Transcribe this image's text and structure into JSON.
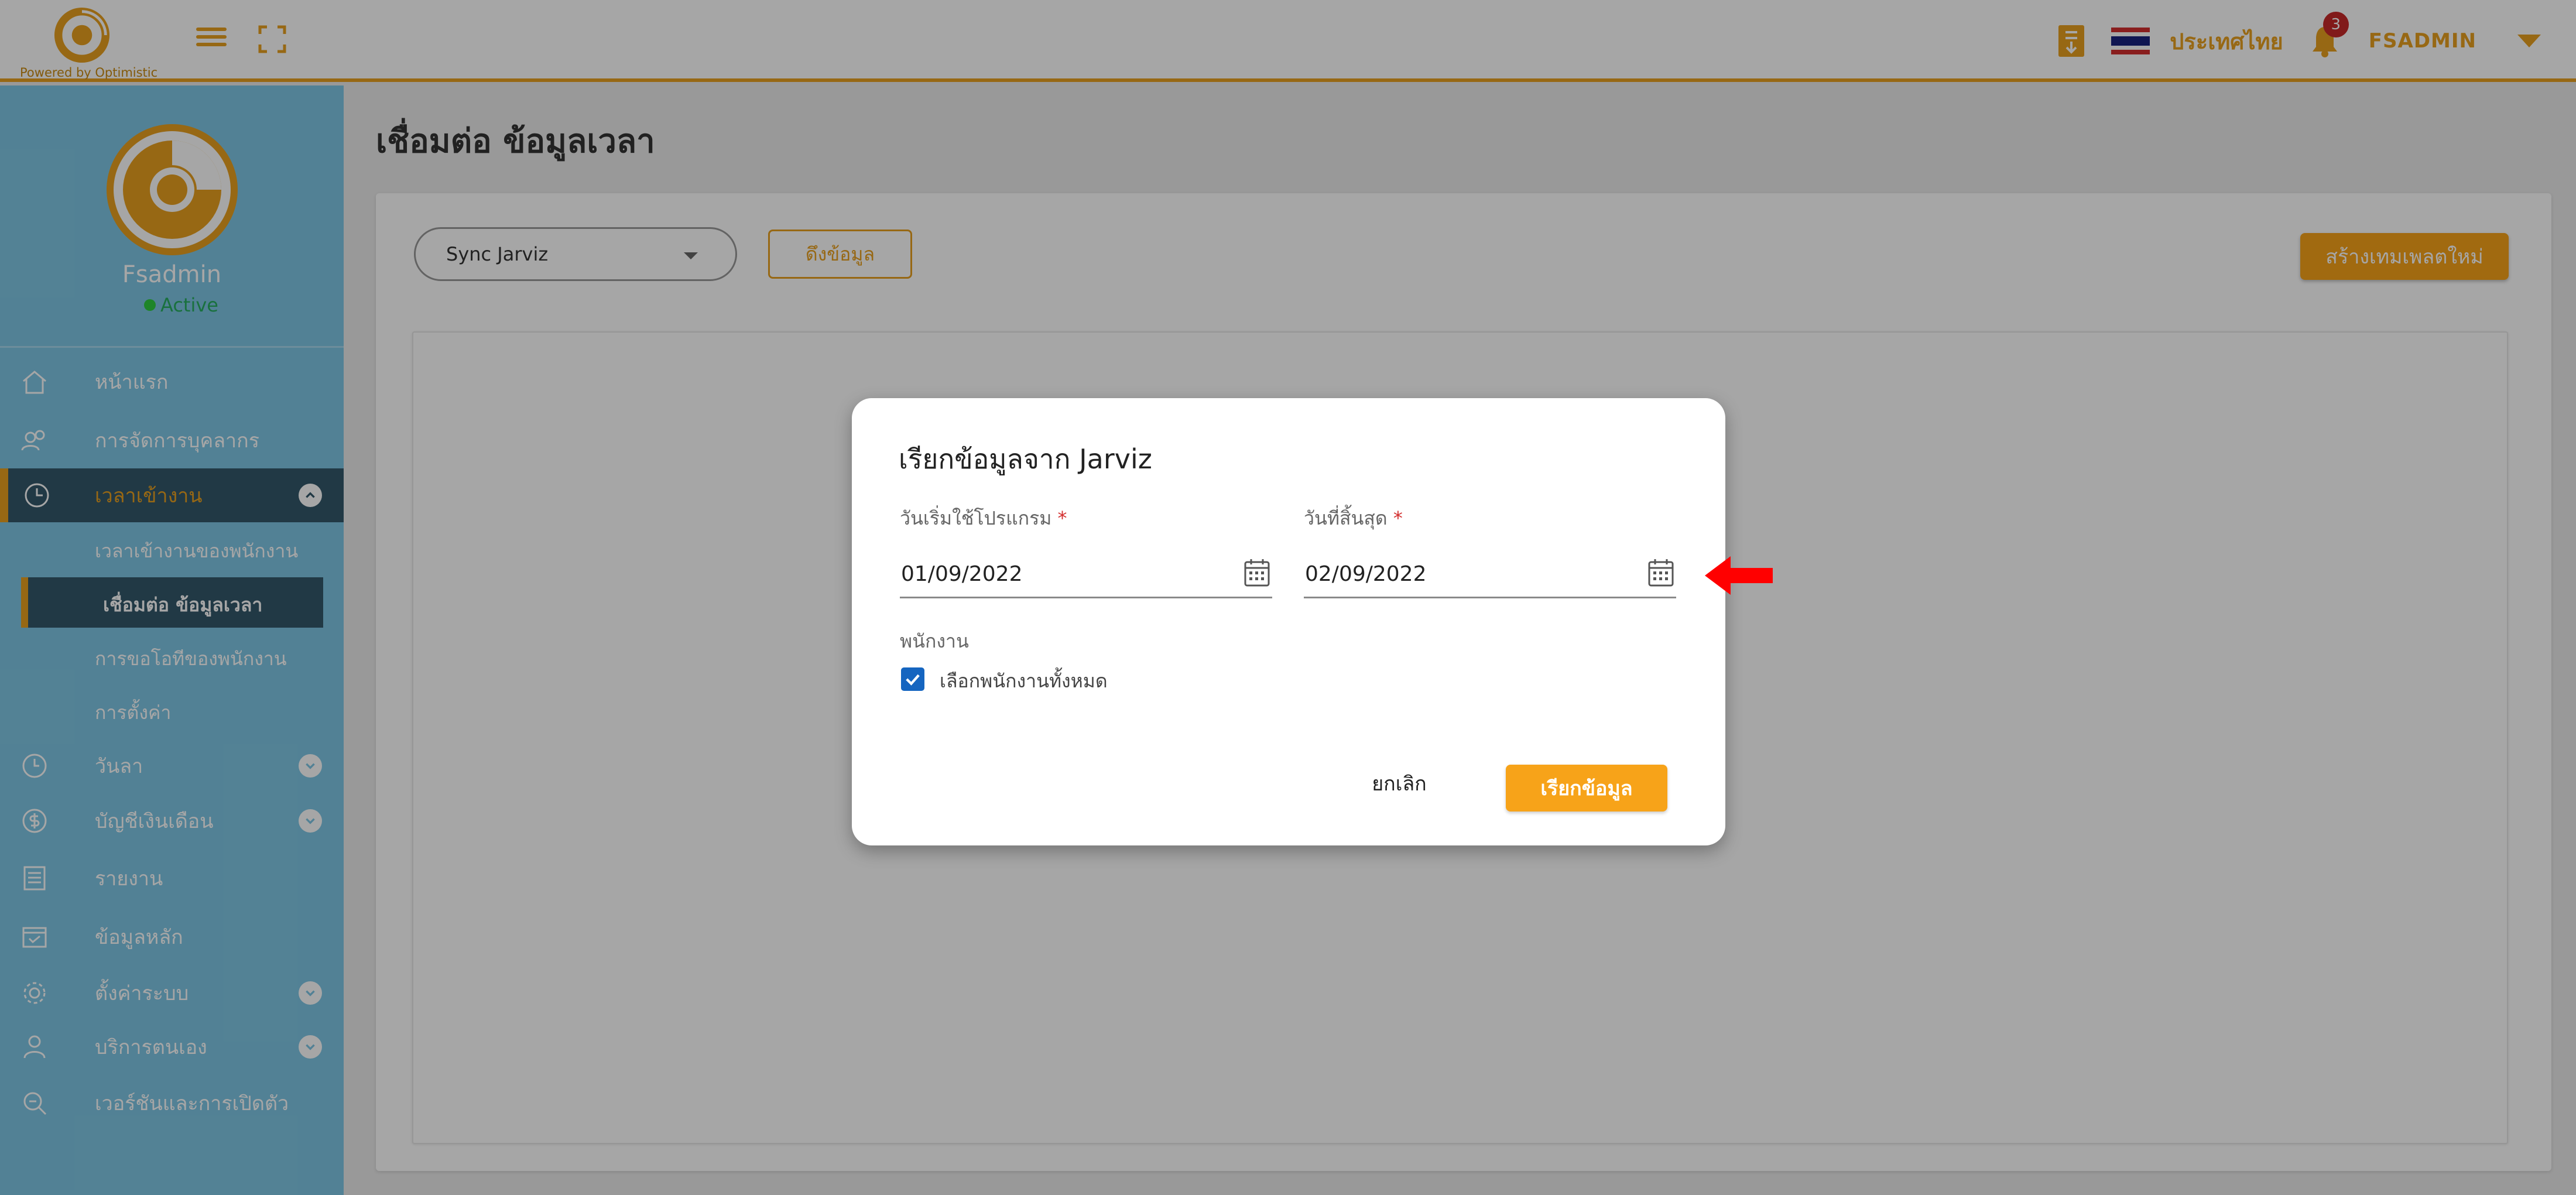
{
  "brand": {
    "tagline": "Powered by Optimistic"
  },
  "header": {
    "country": "ประเทศไทย",
    "notification_count": "3",
    "username": "FSADMIN",
    "accent_color": "#e8a020"
  },
  "profile": {
    "name": "Fsadmin",
    "status": "Active"
  },
  "sidebar": {
    "items": [
      {
        "label": "หน้าแรก",
        "icon": "home-icon"
      },
      {
        "label": "การจัดการบุคลากร",
        "icon": "people-icon"
      },
      {
        "label": "เวลาเข้างาน",
        "icon": "clock-icon",
        "active": true
      },
      {
        "label": "วันลา",
        "icon": "clock-icon"
      },
      {
        "label": "บัญชีเงินเดือน",
        "icon": "dollar-icon"
      },
      {
        "label": "รายงาน",
        "icon": "report-icon"
      },
      {
        "label": "ข้อมูลหลัก",
        "icon": "database-icon"
      },
      {
        "label": "ตั้งค่าระบบ",
        "icon": "gear-icon"
      },
      {
        "label": "บริการตนเอง",
        "icon": "user-icon"
      },
      {
        "label": "เวอร์ชันและการเปิดตัว",
        "icon": "version-icon"
      }
    ],
    "subitems": [
      {
        "label": "เวลาเข้างานของพนักงาน"
      },
      {
        "label": "เชื่อมต่อ ข้อมูลเวลา",
        "active": true
      },
      {
        "label": "การขอโอทีของพนักงาน"
      },
      {
        "label": "การตั้งค่า"
      }
    ]
  },
  "page": {
    "title": "เชื่อมต่อ ข้อมูลเวลา",
    "select_value": "Sync Jarviz",
    "fetch_label": "ดึงข้อมูล",
    "create_label": "สร้างเทมเพลตใหม่"
  },
  "dialog": {
    "title": "เรียกข้อมูลจาก Jarviz",
    "start_label": "วันเริ่มใช้โปรแกรม",
    "start_value": "01/09/2022",
    "end_label": "วันที่สิ้นสุด",
    "end_value": "02/09/2022",
    "required_mark": "*",
    "employee_label": "พนักงาน",
    "select_all_label": "เลือกพนักงานทั้งหมด",
    "select_all_checked": true,
    "cancel_label": "ยกเลิก",
    "submit_label": "เรียกข้อมูล"
  },
  "colors": {
    "sidebar_bg": "#7fc7e5",
    "active_bg": "#34586a",
    "primary_button": "#f7a319",
    "checkbox": "#1565c0",
    "annotation_arrow": "#ff0000"
  }
}
